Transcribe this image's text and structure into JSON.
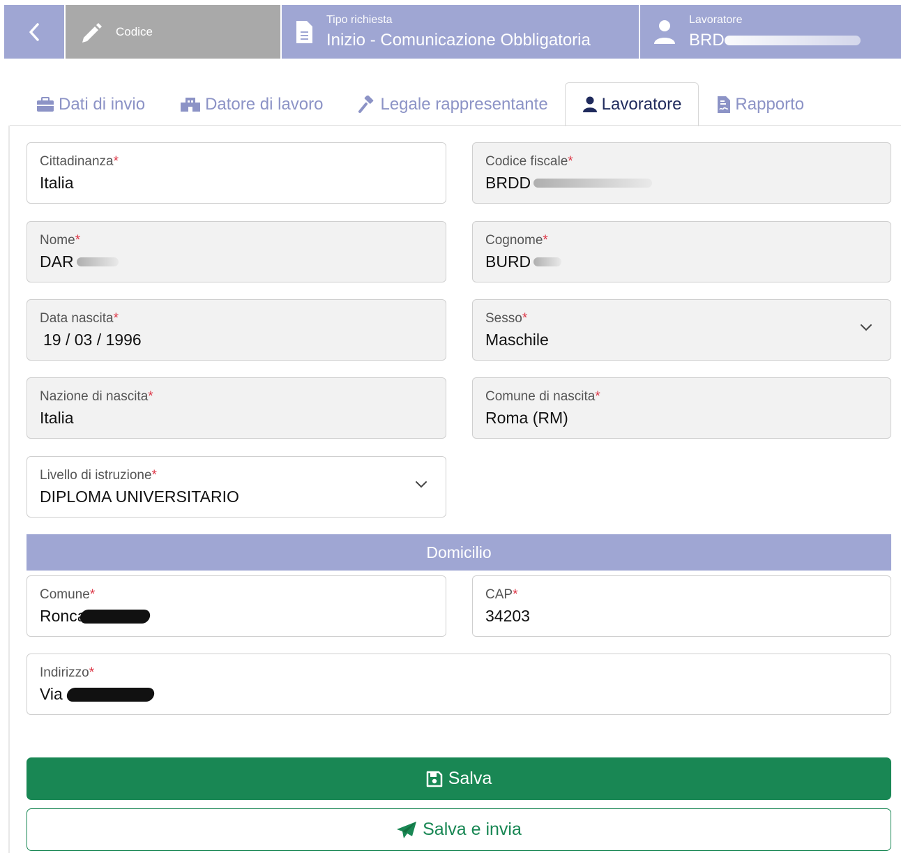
{
  "header": {
    "code_label": "Codice",
    "request_type_label": "Tipo richiesta",
    "request_type_value": "Inizio - Comunicazione Obbligatoria",
    "worker_label": "Lavoratore",
    "worker_value": "BRD"
  },
  "tabs": [
    {
      "label": "Dati di invio",
      "icon": "briefcase-icon",
      "active": false
    },
    {
      "label": "Datore di lavoro",
      "icon": "building-icon",
      "active": false
    },
    {
      "label": "Legale rappresentante",
      "icon": "gavel-icon",
      "active": false
    },
    {
      "label": "Lavoratore",
      "icon": "user-icon",
      "active": true
    },
    {
      "label": "Rapporto",
      "icon": "file-contract-icon",
      "active": false
    }
  ],
  "form": {
    "required_mark": "*",
    "cittadinanza": {
      "label": "Cittadinanza",
      "value": "Italia"
    },
    "codice_fiscale": {
      "label": "Codice fiscale",
      "value": "BRDD"
    },
    "nome": {
      "label": "Nome",
      "value": "DAR"
    },
    "cognome": {
      "label": "Cognome",
      "value": "BURD"
    },
    "data_nascita": {
      "label": "Data nascita",
      "value": "19 / 03 / 1996"
    },
    "sesso": {
      "label": "Sesso",
      "value": "Maschile"
    },
    "nazione_nascita": {
      "label": "Nazione di nascita",
      "value": "Italia"
    },
    "comune_nascita": {
      "label": "Comune di nascita",
      "value": "Roma (RM)"
    },
    "livello_istruzione": {
      "label": "Livello di istruzione",
      "value": "DIPLOMA UNIVERSITARIO"
    }
  },
  "domicilio": {
    "title": "Domicilio",
    "comune": {
      "label": "Comune",
      "value": "Ronca"
    },
    "cap": {
      "label": "CAP",
      "value": "34203"
    },
    "indirizzo": {
      "label": "Indirizzo",
      "value": "Via"
    }
  },
  "buttons": {
    "save": "Salva",
    "save_send": "Salva e invia"
  },
  "colors": {
    "header_bg": "#9fa6d3",
    "code_bg": "#a9a9a9",
    "tab_inactive": "#8c93c6",
    "tab_active": "#1f2a5c",
    "required": "#dc3545",
    "success": "#198754"
  }
}
